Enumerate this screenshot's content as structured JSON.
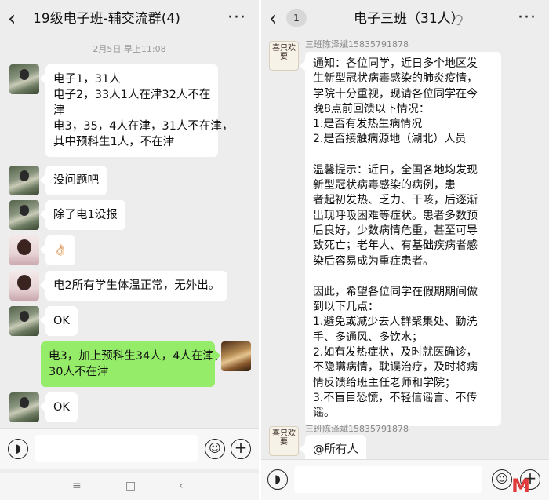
{
  "left": {
    "header": {
      "title": "19级电子班-辅交流群(4)"
    },
    "timestamp": "2月5日 早上11:08",
    "messages": [
      {
        "lines": [
          "电子1，31人",
          "电子2，33人1人在津32人不在",
          "津",
          "电3，35，4人在津，31人不在津，",
          "其中预科生1人，不在津"
        ]
      },
      {
        "lines": [
          "没问题吧"
        ]
      },
      {
        "lines": [
          "除了电1没报"
        ]
      },
      {
        "lines": [
          "👌🏻"
        ]
      },
      {
        "lines": [
          "电2所有学生体温正常，无外出。"
        ]
      },
      {
        "lines": [
          "OK"
        ]
      },
      {
        "lines": [
          "电3，加上预科生34人，4人在津，",
          "30人不在津"
        ]
      },
      {
        "lines": [
          "OK"
        ]
      }
    ]
  },
  "right": {
    "header": {
      "title": "电子三班（31人）",
      "unread_count": "1"
    },
    "sender_name": "三班陈泽斌15835791878",
    "avatar_text": "喜只欢要",
    "notice_lines": [
      "通知：各位同学，近日多个地区发",
      "生新型冠状病毒感染的肺炎疫情，",
      "学院十分重视，现请各位同学在今",
      "晚8点前回馈以下情况：",
      "1.是否有发热生病情况",
      "2.是否接触病源地（湖北）人员",
      "",
      "温馨提示：近日，全国各地均发现",
      "新型冠状病毒感染的病例，患",
      "者起初发热、乏力、干咳，后逐渐",
      "出现呼吸困难等症状。患者多数预",
      "后良好，少数病情危重，甚至可导",
      "致死亡；老年人、有基础疾病者感",
      "染后容易成为重症患者。",
      "",
      "因此，希望各位同学在假期期间做",
      "到以下几点：",
      "1.避免或减少去人群聚集处、勤洗",
      "手、多通风、多饮水；",
      "2.如有发热症状，及时就医确诊，",
      "不隐瞒病情，耽误治疗，及时将病",
      "情反馈给班主任老师和学院；",
      "3.不盲目恐慌，不轻信谣言、不传",
      "谣。"
    ],
    "mention": "@所有人"
  },
  "watermark": "M"
}
